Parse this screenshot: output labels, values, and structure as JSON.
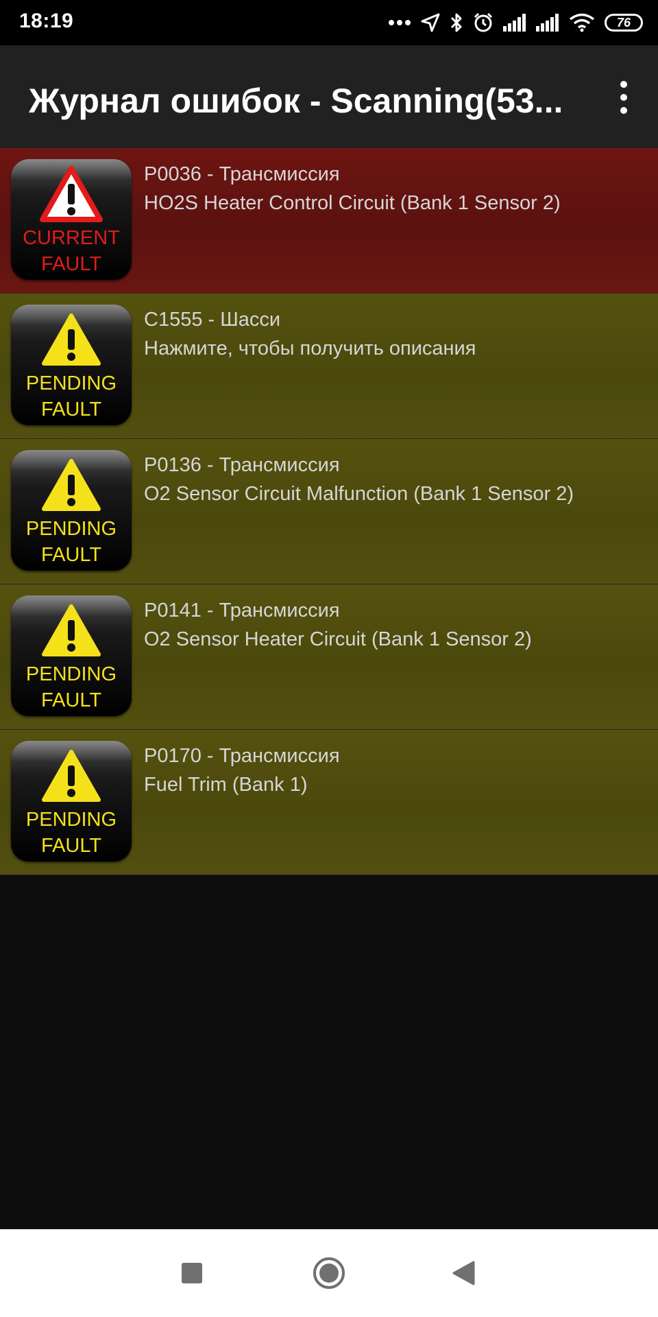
{
  "status_bar": {
    "time": "18:19",
    "battery": "76",
    "icons": [
      "more-dots-icon",
      "location-arrow-icon",
      "bluetooth-icon",
      "alarm-icon",
      "signal-icon",
      "signal-icon",
      "wifi-icon",
      "battery-icon"
    ]
  },
  "app_bar": {
    "title": "Журнал ошибок - Scanning(53...",
    "menu_icon": "overflow-menu-icon"
  },
  "faults": [
    {
      "status": "current",
      "badge_line1": "CURRENT",
      "badge_line2": "FAULT",
      "code": "P0036 - Трансмиссия",
      "description": "HO2S Heater Control Circuit (Bank 1 Sensor 2)"
    },
    {
      "status": "pending",
      "badge_line1": "PENDING",
      "badge_line2": "FAULT",
      "code": "C1555 - Шасси",
      "description": "Нажмите, чтобы получить описания"
    },
    {
      "status": "pending",
      "badge_line1": "PENDING",
      "badge_line2": "FAULT",
      "code": "P0136 - Трансмиссия",
      "description": "O2 Sensor Circuit Malfunction (Bank 1 Sensor 2)"
    },
    {
      "status": "pending",
      "badge_line1": "PENDING",
      "badge_line2": "FAULT",
      "code": "P0141 - Трансмиссия",
      "description": "O2 Sensor Heater Circuit (Bank 1 Sensor 2)"
    },
    {
      "status": "pending",
      "badge_line1": "PENDING",
      "badge_line2": "FAULT",
      "code": "P0170 - Трансмиссия",
      "description": "Fuel Trim (Bank 1)"
    }
  ],
  "colors": {
    "current_row": "#5e1210",
    "pending_row": "#4e4b0d",
    "current_badge_text": "#e31b1b",
    "pending_badge_text": "#f4e11a"
  },
  "nav_bar": {
    "buttons": [
      "recents-square-icon",
      "home-circle-icon",
      "back-triangle-icon"
    ]
  }
}
